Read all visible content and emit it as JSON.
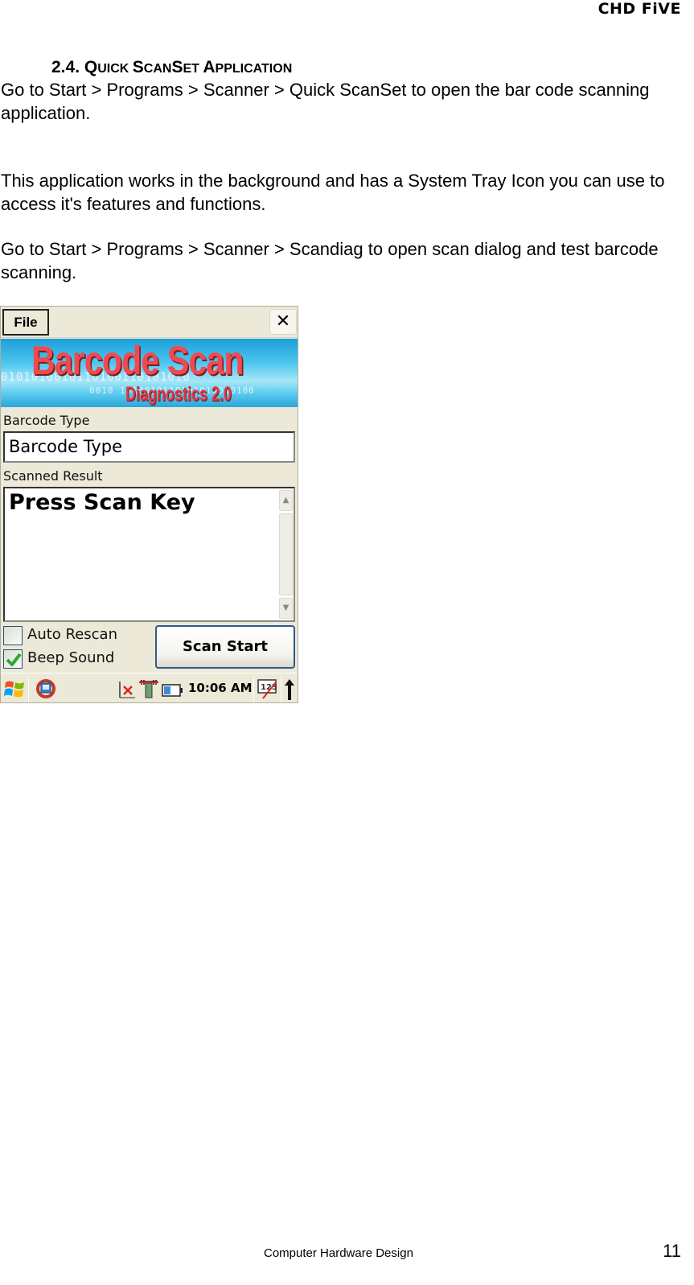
{
  "header": {
    "brand": "CHD FiVE"
  },
  "section": {
    "number": "2.4.",
    "title_parts": [
      {
        "cap": "Q",
        "rest": "UICK "
      },
      {
        "cap": "S",
        "rest": "CAN"
      },
      {
        "cap": "S",
        "rest": "ET "
      },
      {
        "cap": "A",
        "rest": "PPLICATION"
      }
    ],
    "title": "Quick ScanSet Application"
  },
  "paragraphs": [
    "Go to Start > Programs > Scanner > Quick ScanSet to open the bar code scanning application.",
    "This application works in the background and has a System Tray Icon you can use to access it's features and functions.",
    "Go to Start > Programs > Scanner > Scandiag to open scan dialog and test barcode scanning."
  ],
  "device": {
    "menu": {
      "file_label": "File",
      "close_icon": "close-icon"
    },
    "banner": {
      "title": "Barcode Scan",
      "subtitle": "Diagnostics 2.0",
      "bits_line1": "0101010010110100110101010",
      "bits_line2": "0010  1010010110101010010100"
    },
    "barcode_type": {
      "label": "Barcode Type",
      "value": "Barcode Type"
    },
    "scanned_result": {
      "label": "Scanned Result",
      "value": "Press Scan Key"
    },
    "options": [
      {
        "label": "Auto Rescan",
        "checked": false
      },
      {
        "label": "Beep Sound",
        "checked": true
      }
    ],
    "scan_button": "Scan Start",
    "taskbar": {
      "start_icon": "windows-start-icon",
      "sync_icon": "activesync-icon",
      "tray_icons": [
        "network-disconnected-icon",
        "signal-off-icon",
        "battery-icon"
      ],
      "clock": "10:06 AM",
      "input_icon": "keyboard-123-icon",
      "arrow_icon": "up-arrow-icon"
    },
    "colors": {
      "banner_text": "#f04a50",
      "check": "#2fa630",
      "button_border": "#2f5b8a"
    }
  },
  "footer": {
    "text": "Computer Hardware Design",
    "page": "11"
  }
}
